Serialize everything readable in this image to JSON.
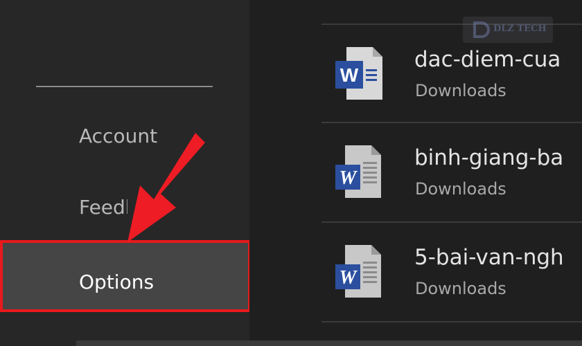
{
  "sidebar": {
    "items": [
      {
        "label": "Account"
      },
      {
        "label": "Feedback"
      },
      {
        "label": "Options"
      }
    ]
  },
  "recent_files": [
    {
      "name": "dac-diem-cua",
      "location": "Downloads",
      "icon": "word-document-icon"
    },
    {
      "name": "binh-giang-ba",
      "location": "Downloads",
      "icon": "word-document-icon"
    },
    {
      "name": "5-bai-van-ngh",
      "location": "Downloads",
      "icon": "word-document-icon"
    }
  ],
  "watermark": {
    "text": "DLZ TECH"
  },
  "colors": {
    "highlight_border": "#e8191c",
    "arrow": "#ee1c24",
    "selected_background": "#454545",
    "word_blue": "#2b4f9e"
  }
}
